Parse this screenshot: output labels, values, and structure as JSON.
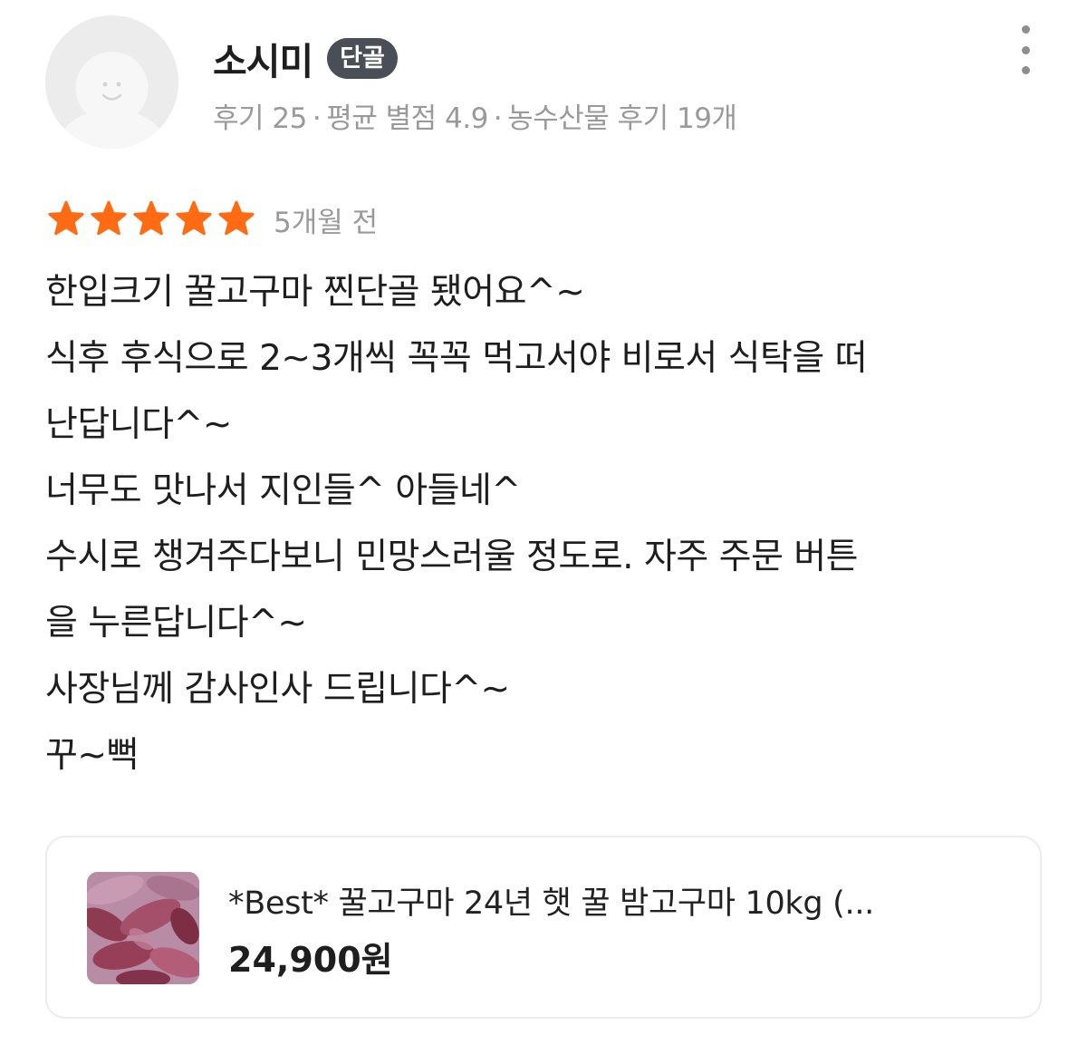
{
  "user": {
    "name": "소시미",
    "badge": "단골",
    "review_count": "후기 25",
    "average_rating": "평균 별점 4.9",
    "category_count": "농수산물 후기 19개",
    "separator": "·"
  },
  "review": {
    "rating": 5,
    "rating_max": 5,
    "star_color": "#ff6b12",
    "date": "5개월 전",
    "lines": [
      "한입크기 꿀고구마 찐단골 됐어요^~",
      "식후 후식으로 2~3개씩 꼭꼭 먹고서야 비로서 식탁을 떠",
      "난답니다^~",
      "너무도 맛나서 지인들^ 아들네^",
      "수시로 챙겨주다보니 민망스러울 정도로. 자주 주문 버튼",
      "을 누른답니다^~",
      "사장님께 감사인사 드립니다^~",
      "꾸~뻑"
    ]
  },
  "product": {
    "name": "*Best* 꿀고구마 24년 햇 꿀 밤고구마 10kg (...",
    "price": "24,900원"
  },
  "icons": {
    "avatar": "default-avatar-icon",
    "more": "more-vertical-icon",
    "star": "star-icon"
  }
}
